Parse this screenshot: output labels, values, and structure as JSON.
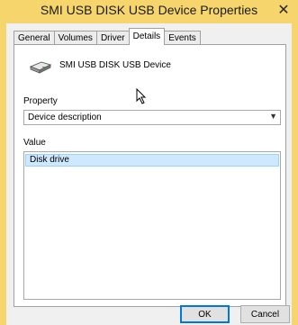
{
  "window": {
    "title": "SMI USB DISK USB Device Properties",
    "close_icon": "close-icon",
    "frame_color": "#f6d66c"
  },
  "tabs": [
    {
      "label": "General",
      "active": false
    },
    {
      "label": "Volumes",
      "active": false
    },
    {
      "label": "Driver",
      "active": false
    },
    {
      "label": "Details",
      "active": true
    },
    {
      "label": "Events",
      "active": false
    }
  ],
  "details": {
    "device_icon": "disk-drive-icon",
    "device_name": "SMI USB DISK USB Device",
    "property_label": "Property",
    "property_value": "Device description",
    "value_label": "Value",
    "values": [
      "Disk drive"
    ]
  },
  "buttons": {
    "ok": "OK",
    "cancel": "Cancel"
  }
}
